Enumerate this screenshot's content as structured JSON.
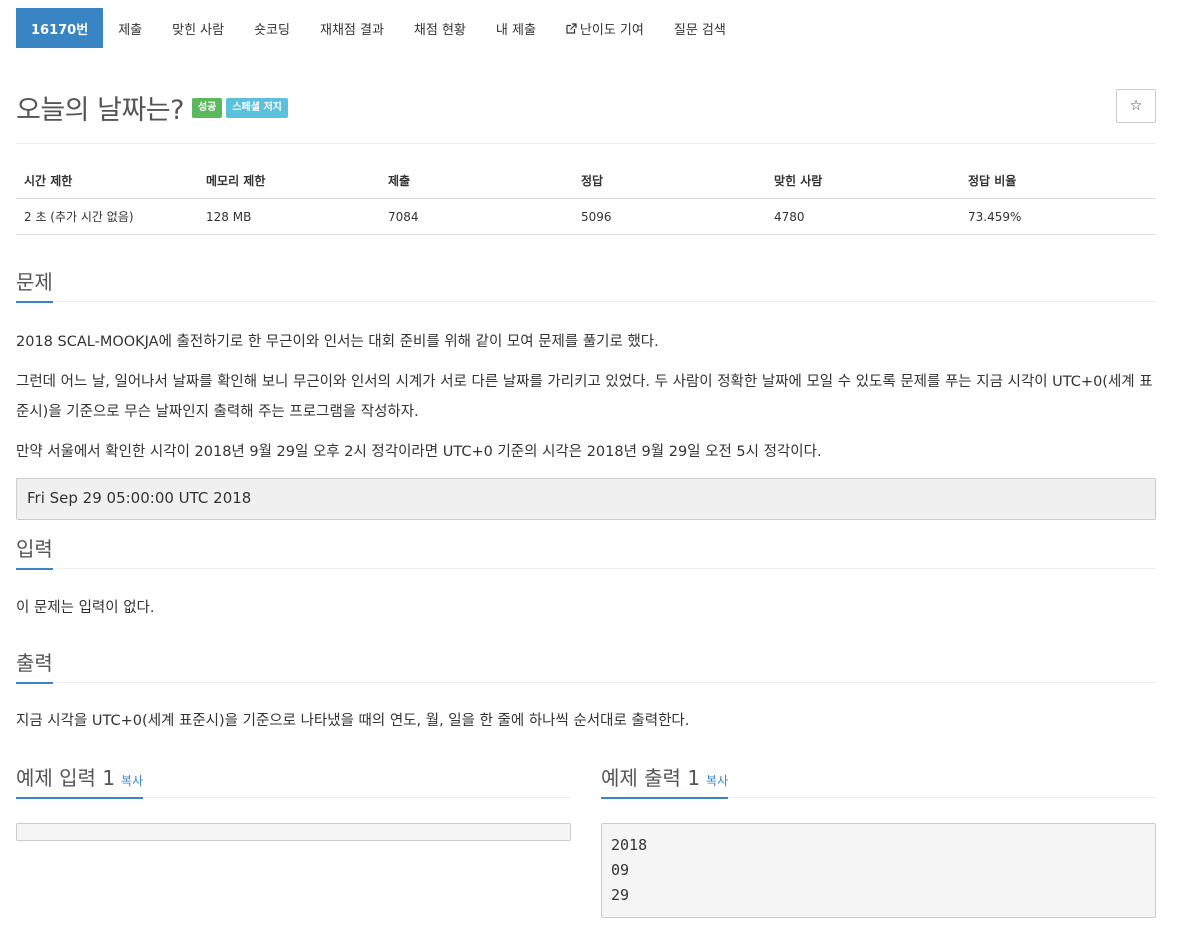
{
  "nav": {
    "items": [
      {
        "label": "16170번",
        "active": true
      },
      {
        "label": "제출"
      },
      {
        "label": "맞힌 사람"
      },
      {
        "label": "숏코딩"
      },
      {
        "label": "재채점 결과"
      },
      {
        "label": "채점 현황"
      },
      {
        "label": "내 제출"
      },
      {
        "label": "난이도 기여",
        "icon": "external-link-icon"
      },
      {
        "label": "질문 검색"
      }
    ]
  },
  "problem": {
    "title": "오늘의 날짜는?",
    "badges": [
      "성공",
      "스페셜 저지"
    ],
    "star_icon": "star-icon"
  },
  "stats": {
    "headers": [
      "시간 제한",
      "메모리 제한",
      "제출",
      "정답",
      "맞힌 사람",
      "정답 비율"
    ],
    "values": [
      "2 초 (추가 시간 없음)",
      "128 MB",
      "7084",
      "5096",
      "4780",
      "73.459%"
    ]
  },
  "sections": {
    "problem_title": "문제",
    "p1": "2018 SCAL-MOOKJA에 출전하기로 한 무근이와 인서는 대회 준비를 위해 같이 모여 문제를 풀기로 했다.",
    "p2": "그런데 어느 날, 일어나서 날짜를 확인해 보니 무근이와 인서의 시계가 서로 다른 날짜를 가리키고 있었다. 두 사람이 정확한 날짜에 모일 수 있도록 문제를 푸는 지금 시각이 UTC+0(세계 표준시)을 기준으로 무슨 날짜인지 출력해 주는 프로그램을 작성하자.",
    "p3": "만약 서울에서 확인한 시각이 2018년 9월 29일 오후 2시 정각이라면 UTC+0 기준의 시각은 2018년 9월 29일 오전 5시 정각이다.",
    "code": "Fri Sep 29 05:00:00 UTC 2018",
    "input_title": "입력",
    "input_text": "이 문제는 입력이 없다.",
    "output_title": "출력",
    "output_text": "지금 시각을 UTC+0(세계 표준시)을 기준으로 나타냈을 때의 연도, 월, 일을 한 줄에 하나씩 순서대로 출력한다.",
    "sample_input_title": "예제 입력 1",
    "sample_output_title": "예제 출력 1",
    "copy_label": "복사",
    "sample_input": "",
    "sample_output": "2018\n09\n29"
  },
  "colors": {
    "accent": "#3984c3",
    "success": "#5cb85c",
    "info": "#5bc0de"
  }
}
